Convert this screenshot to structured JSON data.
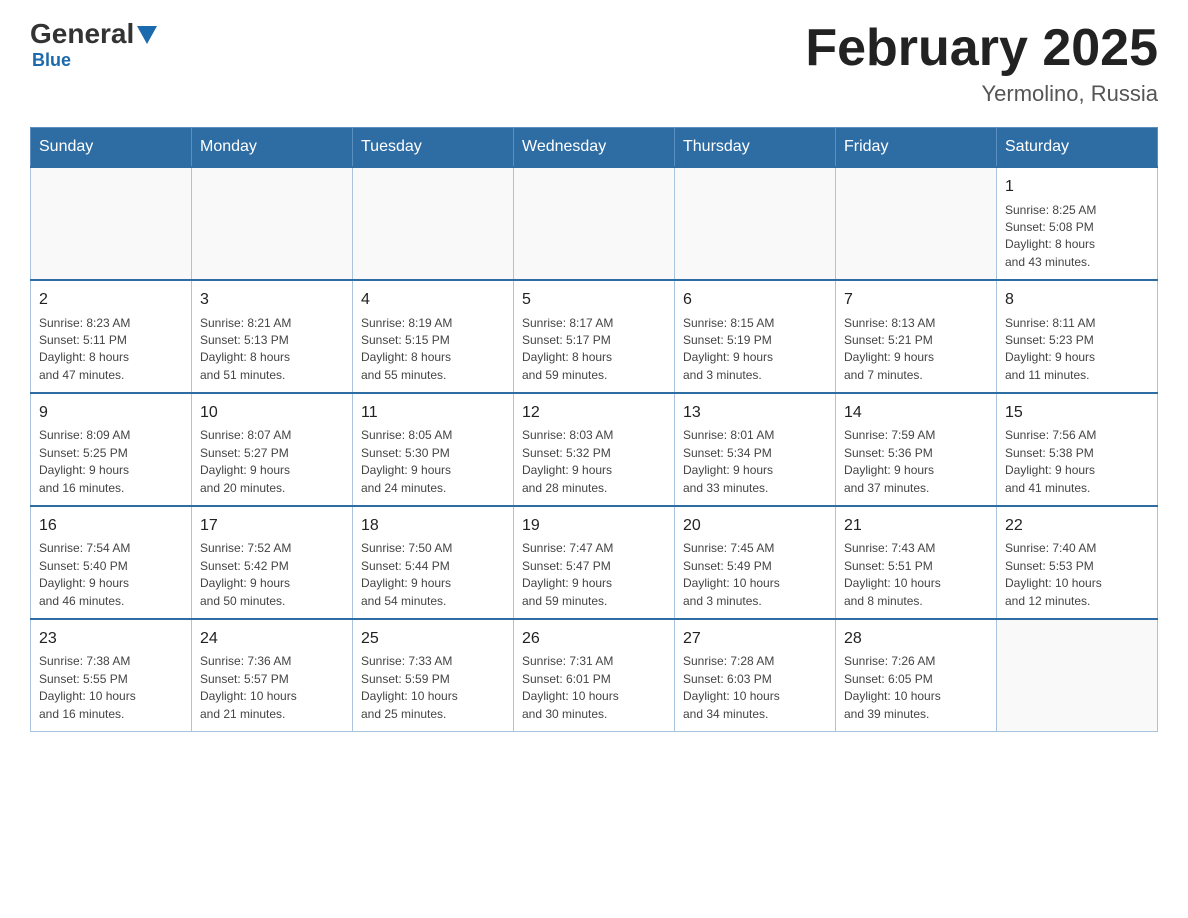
{
  "header": {
    "logo_main": "General",
    "logo_sub": "Blue",
    "month_title": "February 2025",
    "location": "Yermolino, Russia"
  },
  "weekdays": [
    "Sunday",
    "Monday",
    "Tuesday",
    "Wednesday",
    "Thursday",
    "Friday",
    "Saturday"
  ],
  "weeks": [
    [
      {
        "day": "",
        "info": ""
      },
      {
        "day": "",
        "info": ""
      },
      {
        "day": "",
        "info": ""
      },
      {
        "day": "",
        "info": ""
      },
      {
        "day": "",
        "info": ""
      },
      {
        "day": "",
        "info": ""
      },
      {
        "day": "1",
        "info": "Sunrise: 8:25 AM\nSunset: 5:08 PM\nDaylight: 8 hours\nand 43 minutes."
      }
    ],
    [
      {
        "day": "2",
        "info": "Sunrise: 8:23 AM\nSunset: 5:11 PM\nDaylight: 8 hours\nand 47 minutes."
      },
      {
        "day": "3",
        "info": "Sunrise: 8:21 AM\nSunset: 5:13 PM\nDaylight: 8 hours\nand 51 minutes."
      },
      {
        "day": "4",
        "info": "Sunrise: 8:19 AM\nSunset: 5:15 PM\nDaylight: 8 hours\nand 55 minutes."
      },
      {
        "day": "5",
        "info": "Sunrise: 8:17 AM\nSunset: 5:17 PM\nDaylight: 8 hours\nand 59 minutes."
      },
      {
        "day": "6",
        "info": "Sunrise: 8:15 AM\nSunset: 5:19 PM\nDaylight: 9 hours\nand 3 minutes."
      },
      {
        "day": "7",
        "info": "Sunrise: 8:13 AM\nSunset: 5:21 PM\nDaylight: 9 hours\nand 7 minutes."
      },
      {
        "day": "8",
        "info": "Sunrise: 8:11 AM\nSunset: 5:23 PM\nDaylight: 9 hours\nand 11 minutes."
      }
    ],
    [
      {
        "day": "9",
        "info": "Sunrise: 8:09 AM\nSunset: 5:25 PM\nDaylight: 9 hours\nand 16 minutes."
      },
      {
        "day": "10",
        "info": "Sunrise: 8:07 AM\nSunset: 5:27 PM\nDaylight: 9 hours\nand 20 minutes."
      },
      {
        "day": "11",
        "info": "Sunrise: 8:05 AM\nSunset: 5:30 PM\nDaylight: 9 hours\nand 24 minutes."
      },
      {
        "day": "12",
        "info": "Sunrise: 8:03 AM\nSunset: 5:32 PM\nDaylight: 9 hours\nand 28 minutes."
      },
      {
        "day": "13",
        "info": "Sunrise: 8:01 AM\nSunset: 5:34 PM\nDaylight: 9 hours\nand 33 minutes."
      },
      {
        "day": "14",
        "info": "Sunrise: 7:59 AM\nSunset: 5:36 PM\nDaylight: 9 hours\nand 37 minutes."
      },
      {
        "day": "15",
        "info": "Sunrise: 7:56 AM\nSunset: 5:38 PM\nDaylight: 9 hours\nand 41 minutes."
      }
    ],
    [
      {
        "day": "16",
        "info": "Sunrise: 7:54 AM\nSunset: 5:40 PM\nDaylight: 9 hours\nand 46 minutes."
      },
      {
        "day": "17",
        "info": "Sunrise: 7:52 AM\nSunset: 5:42 PM\nDaylight: 9 hours\nand 50 minutes."
      },
      {
        "day": "18",
        "info": "Sunrise: 7:50 AM\nSunset: 5:44 PM\nDaylight: 9 hours\nand 54 minutes."
      },
      {
        "day": "19",
        "info": "Sunrise: 7:47 AM\nSunset: 5:47 PM\nDaylight: 9 hours\nand 59 minutes."
      },
      {
        "day": "20",
        "info": "Sunrise: 7:45 AM\nSunset: 5:49 PM\nDaylight: 10 hours\nand 3 minutes."
      },
      {
        "day": "21",
        "info": "Sunrise: 7:43 AM\nSunset: 5:51 PM\nDaylight: 10 hours\nand 8 minutes."
      },
      {
        "day": "22",
        "info": "Sunrise: 7:40 AM\nSunset: 5:53 PM\nDaylight: 10 hours\nand 12 minutes."
      }
    ],
    [
      {
        "day": "23",
        "info": "Sunrise: 7:38 AM\nSunset: 5:55 PM\nDaylight: 10 hours\nand 16 minutes."
      },
      {
        "day": "24",
        "info": "Sunrise: 7:36 AM\nSunset: 5:57 PM\nDaylight: 10 hours\nand 21 minutes."
      },
      {
        "day": "25",
        "info": "Sunrise: 7:33 AM\nSunset: 5:59 PM\nDaylight: 10 hours\nand 25 minutes."
      },
      {
        "day": "26",
        "info": "Sunrise: 7:31 AM\nSunset: 6:01 PM\nDaylight: 10 hours\nand 30 minutes."
      },
      {
        "day": "27",
        "info": "Sunrise: 7:28 AM\nSunset: 6:03 PM\nDaylight: 10 hours\nand 34 minutes."
      },
      {
        "day": "28",
        "info": "Sunrise: 7:26 AM\nSunset: 6:05 PM\nDaylight: 10 hours\nand 39 minutes."
      },
      {
        "day": "",
        "info": ""
      }
    ]
  ]
}
